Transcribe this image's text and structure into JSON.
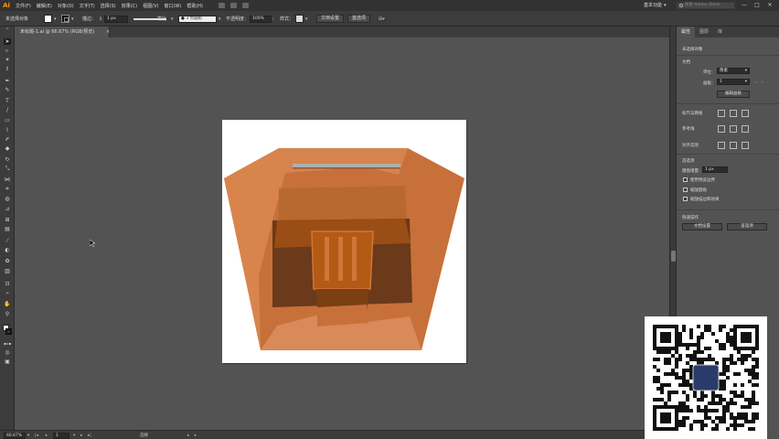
{
  "menubar": {
    "logo": "Ai",
    "items": [
      "文件(F)",
      "编辑(E)",
      "对象(O)",
      "文字(T)",
      "选择(S)",
      "效果(C)",
      "视图(V)",
      "窗口(W)",
      "帮助(H)"
    ],
    "workspace": "基本功能",
    "search_placeholder": "搜索 Adobe Stock",
    "minimize": "—",
    "maximize": "□",
    "close": "✕"
  },
  "controlbar": {
    "selection_label": "未选择对象",
    "stroke_label": "描边：",
    "stroke_value": "1 px",
    "stroke_style": "等比",
    "brush_value": "3 点圆形",
    "opacity_label": "不透明度：",
    "opacity_value": "100%",
    "style_label": "样式：",
    "doc_setup_button": "文档设置",
    "preferences_button": "首选项"
  },
  "document": {
    "tab_title": "未标题-1.ai @ 66.67% (RGB/预览)",
    "tab_close": "✕"
  },
  "statusbar": {
    "zoom": "66.67%",
    "page": "1",
    "tool": "选择"
  },
  "panel": {
    "tabs": [
      "属性",
      "图层",
      "库"
    ],
    "no_selection": "未选择对象",
    "document_section": "文档",
    "units_label": "单位：",
    "units_value": "像素",
    "artboard_label": "画板：",
    "artboard_value": "1",
    "edit_artboard_button": "编辑画板",
    "rulers_grid_label": "标尺与网格",
    "guides_label": "参考线",
    "align_label": "对齐选项",
    "preferences_section": "首选项",
    "keyboard_increment_label": "键盘增量：",
    "keyboard_increment_value": "1 px",
    "check_preview_bounds": "使用预览边界",
    "check_scale_corners": "缩放圆角",
    "check_scale_strokes": "缩放描边和效果",
    "quick_actions_section": "快速操作",
    "doc_setup_button": "文档设置",
    "preferences_button": "首选项"
  },
  "colors": {
    "app_bg": "#535353",
    "panel_dark": "#3c3c3c",
    "logo_orange": "#ff9a00",
    "art_orange": "#c8703a",
    "art_dark": "#6a3a1a",
    "art_chair": "#b35a15"
  }
}
